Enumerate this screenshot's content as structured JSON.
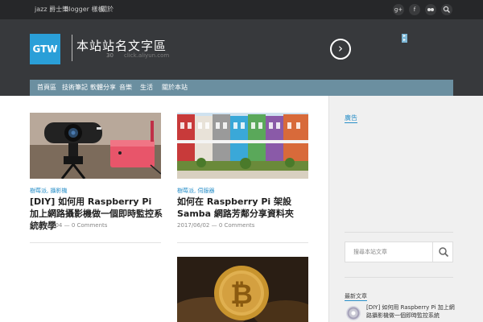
{
  "topbar": {
    "nav": [
      "jazz 爵士樂",
      "Blogger 樣板",
      "關於"
    ],
    "social_icons": [
      {
        "name": "google-plus-icon",
        "glyph": "g+"
      },
      {
        "name": "facebook-icon",
        "glyph": "f"
      },
      {
        "name": "flickr-icon",
        "glyph": "▪▪"
      },
      {
        "name": "search-icon",
        "glyph": "⚲"
      }
    ]
  },
  "header": {
    "logo_text": "GTW",
    "site_title": "本站站名文字區",
    "subtitle_number": "30",
    "subtitle_url": "click.aliyun.com",
    "next_arrow": "›"
  },
  "mainnav": [
    "首頁區",
    "技術筆記",
    "軟體分享",
    "音樂",
    "生活",
    "關於本站"
  ],
  "posts": [
    {
      "category": "樹莓派, 攝影機",
      "title": "[DIY] 如何用 Raspberry Pi 加上網路攝影機做一個即時監控系統教學",
      "date": "2017/06/04",
      "comments": "0 Comments",
      "image": "webcam-raspberry-pi"
    },
    {
      "category": "樹莓派, 伺服器",
      "title": "如何在 Raspberry Pi 架設 Samba 網路芳鄰分享資料夾",
      "date": "2017/06/02",
      "comments": "0 Comments",
      "image": "colorful-row-houses"
    },
    {
      "category": "",
      "title": "",
      "date": "",
      "comments": "",
      "image": "bitcoin-coins"
    }
  ],
  "sidebar": {
    "heading_1": "廣告",
    "search_placeholder": "搜尋本站文章",
    "search_icon": "search-icon",
    "heading_2": "最新文章",
    "recent_post_title": "[DIY] 如何用 Raspberry Pi 加上網路攝影機做一個即時監控系統"
  },
  "colors": {
    "topbar": "#262729",
    "header": "#37393c",
    "nav": "#6b8fa0",
    "accent": "#2a8fc8",
    "logo": "#2a9fd8"
  }
}
